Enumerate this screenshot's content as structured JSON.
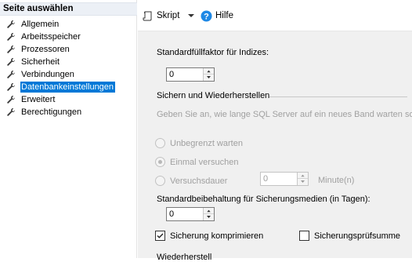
{
  "sidebar": {
    "header": "Seite auswählen",
    "items": [
      {
        "label": "Allgemein",
        "selected": false
      },
      {
        "label": "Arbeitsspeicher",
        "selected": false
      },
      {
        "label": "Prozessoren",
        "selected": false
      },
      {
        "label": "Sicherheit",
        "selected": false
      },
      {
        "label": "Verbindungen",
        "selected": false
      },
      {
        "label": "Datenbankeinstellungen",
        "selected": true
      },
      {
        "label": "Erweitert",
        "selected": false
      },
      {
        "label": "Berechtigungen",
        "selected": false
      }
    ]
  },
  "toolbar": {
    "script_label": "Skript",
    "help_label": "Hilfe"
  },
  "main": {
    "fill_factor_label": "Standardfüllfaktor für Indizes:",
    "fill_factor_value": "0",
    "backup_restore_section": "Sichern und Wiederherstellen",
    "tape_wait_prompt": "Geben Sie an, wie lange SQL Server auf ein neues Band warten soll.",
    "radio_unlimited": "Unbegrenzt warten",
    "radio_once": "Einmal versuchen",
    "radio_duration": "Versuchsdauer",
    "duration_value": "0",
    "duration_unit": "Minute(n)",
    "retention_label": "Standardbeibehaltung für Sicherungsmedien (in Tagen):",
    "retention_value": "0",
    "compress_label": "Sicherung komprimieren",
    "compress_checked": true,
    "checksum_label": "Sicherungsprüfsumme",
    "checksum_checked": false,
    "next_section_partial": "Wiederherstell"
  },
  "colors": {
    "selection": "#0078d7",
    "panel_bg": "#f0f0f0",
    "disabled_text": "#a0a0a0",
    "help_icon": "#1e88e5"
  }
}
